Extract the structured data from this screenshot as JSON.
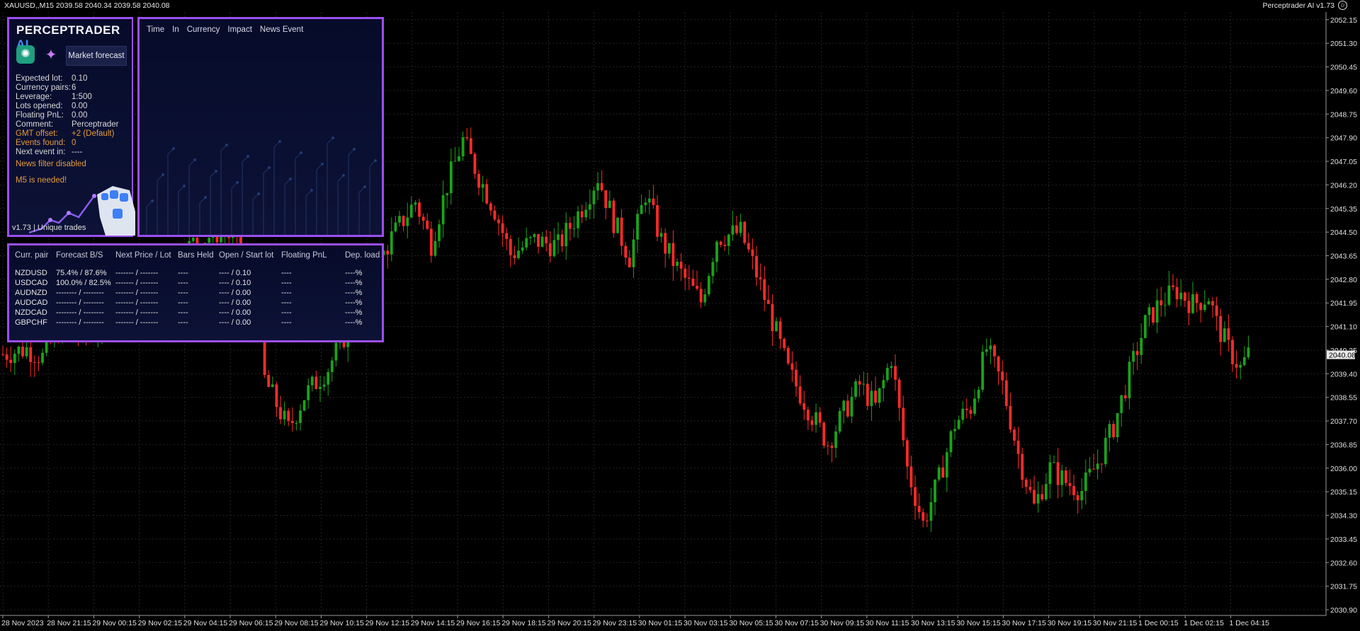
{
  "header": {
    "symbol_info": "XAUUSD,,M15  2039.58 2040.34 2039.58 2040.08",
    "ea_label": "Perceptrader AI v1.73"
  },
  "colors": {
    "bull": "#1aa31a",
    "bear": "#ff2a2a",
    "panel_border": "#9b4ff0",
    "orange": "#e59a3c",
    "logo_accent": "#3f8ff8"
  },
  "icons": {
    "chatgpt": "chatgpt-icon",
    "sparkle": "sparkle-icon",
    "smiley": "smiley-icon",
    "robot": "robot-hand-icon"
  },
  "panel": {
    "logo_main": "PERCEPTRADER",
    "logo_ai": " AI",
    "forecast_button": "Market forecast",
    "stats": [
      {
        "label": "Expected lot:",
        "value": "0.10",
        "orange": false
      },
      {
        "label": "Currency pairs:",
        "value": "6",
        "orange": false
      },
      {
        "label": "Leverage:",
        "value": "1:500",
        "orange": false
      },
      {
        "label": "Lots opened:",
        "value": "0.00",
        "orange": false
      },
      {
        "label": "Floating PnL:",
        "value": "0.00",
        "orange": false
      },
      {
        "label": "Comment:",
        "value": "Perceptrader",
        "orange": false
      },
      {
        "label": "GMT offset:",
        "value": "+2 (Default)",
        "orange": true
      },
      {
        "label": "Events found:",
        "value": "0",
        "orange": true
      },
      {
        "label": "Next event in:",
        "value": "----",
        "orange": false
      }
    ],
    "news_filter": "News filter disabled",
    "m5_needed": "M5 is needed!",
    "version": "v1.73 | Unique trades"
  },
  "news": {
    "headers": [
      "Time",
      "In",
      "Currency",
      "Impact",
      "News Event"
    ]
  },
  "pairs_table": {
    "headers": [
      "Curr. pair",
      "Forecast B/S",
      "Next Price / Lot",
      "Bars Held",
      "Open / Start lot",
      "Floating PnL",
      "Dep. load"
    ],
    "rows": [
      [
        "NZDUSD",
        "75.4% / 87.6%",
        "------- / -------",
        "----",
        "---- / 0.10",
        "----",
        "----%"
      ],
      [
        "USDCAD",
        "100.0% / 82.5%",
        "------- / -------",
        "----",
        "---- / 0.10",
        "----",
        "----%"
      ],
      [
        "AUDNZD",
        "-------- / --------",
        "------- / -------",
        "----",
        "---- / 0.00",
        "----",
        "----%"
      ],
      [
        "AUDCAD",
        "-------- / --------",
        "------- / -------",
        "----",
        "---- / 0.00",
        "----",
        "----%"
      ],
      [
        "NZDCAD",
        "-------- / --------",
        "------- / -------",
        "----",
        "---- / 0.00",
        "----",
        "----%"
      ],
      [
        "GBPCHF",
        "-------- / --------",
        "------- / -------",
        "----",
        "---- / 0.00",
        "----",
        "----%"
      ]
    ]
  },
  "chart_data": {
    "type": "candlestick",
    "symbol": "XAUUSD",
    "timeframe": "M15",
    "ylim": [
      2030.9,
      2052.4
    ],
    "y_ticks": [
      "2052.15",
      "2051.30",
      "2050.45",
      "2049.60",
      "2048.75",
      "2047.90",
      "2047.05",
      "2046.20",
      "2045.35",
      "2044.50",
      "2043.65",
      "2042.80",
      "2041.95",
      "2041.10",
      "2040.25",
      "2039.40",
      "2038.55",
      "2037.70",
      "2036.85",
      "2036.00",
      "2035.15",
      "2034.30",
      "2033.45",
      "2032.60",
      "2031.75",
      "2030.90"
    ],
    "current_price": "2040.08",
    "x_ticks": [
      "28 Nov 2023",
      "28 Nov 21:15",
      "29 Nov 00:15",
      "29 Nov 02:15",
      "29 Nov 04:15",
      "29 Nov 06:15",
      "29 Nov 08:15",
      "29 Nov 10:15",
      "29 Nov 12:15",
      "29 Nov 14:15",
      "29 Nov 16:15",
      "29 Nov 18:15",
      "29 Nov 20:15",
      "29 Nov 23:15",
      "30 Nov 01:15",
      "30 Nov 03:15",
      "30 Nov 05:15",
      "30 Nov 07:15",
      "30 Nov 09:15",
      "30 Nov 11:15",
      "30 Nov 13:15",
      "30 Nov 15:15",
      "30 Nov 17:15",
      "30 Nov 19:15",
      "30 Nov 21:15",
      "1 Dec 00:15",
      "1 Dec 02:15",
      "1 Dec 04:15"
    ],
    "grid": true,
    "anchors": [
      [
        0,
        2040.1
      ],
      [
        6,
        2040.3
      ],
      [
        10,
        2040.0
      ],
      [
        14,
        2041.0
      ],
      [
        20,
        2040.8
      ],
      [
        28,
        2041.5
      ],
      [
        34,
        2042.3
      ],
      [
        40,
        2043.0
      ],
      [
        48,
        2044.1
      ],
      [
        56,
        2044.6
      ],
      [
        62,
        2043.2
      ],
      [
        66,
        2039.2
      ],
      [
        72,
        2037.4
      ],
      [
        76,
        2038.6
      ],
      [
        82,
        2039.6
      ],
      [
        88,
        2041.3
      ],
      [
        92,
        2042.6
      ],
      [
        98,
        2044.3
      ],
      [
        104,
        2045.6
      ],
      [
        108,
        2044.1
      ],
      [
        112,
        2046.2
      ],
      [
        116,
        2047.8
      ],
      [
        120,
        2046.5
      ],
      [
        124,
        2045.3
      ],
      [
        128,
        2043.7
      ],
      [
        134,
        2044.2
      ],
      [
        140,
        2044.0
      ],
      [
        146,
        2045.4
      ],
      [
        150,
        2046.5
      ],
      [
        154,
        2044.9
      ],
      [
        158,
        2043.6
      ],
      [
        162,
        2045.9
      ],
      [
        166,
        2044.2
      ],
      [
        170,
        2043.2
      ],
      [
        176,
        2042.0
      ],
      [
        180,
        2044.3
      ],
      [
        186,
        2044.5
      ],
      [
        190,
        2043.0
      ],
      [
        194,
        2041.3
      ],
      [
        198,
        2039.5
      ],
      [
        204,
        2037.9
      ],
      [
        208,
        2036.9
      ],
      [
        212,
        2038.0
      ],
      [
        216,
        2039.0
      ],
      [
        220,
        2038.2
      ],
      [
        224,
        2040.0
      ],
      [
        228,
        2036.0
      ],
      [
        232,
        2034.0
      ],
      [
        236,
        2035.6
      ],
      [
        240,
        2037.6
      ],
      [
        244,
        2038.2
      ],
      [
        248,
        2040.3
      ],
      [
        252,
        2039.0
      ],
      [
        256,
        2036.5
      ],
      [
        260,
        2034.6
      ],
      [
        264,
        2036.0
      ],
      [
        268,
        2035.5
      ],
      [
        272,
        2035.2
      ],
      [
        276,
        2036.2
      ],
      [
        280,
        2037.5
      ],
      [
        284,
        2039.4
      ],
      [
        288,
        2041.2
      ],
      [
        292,
        2042.0
      ],
      [
        296,
        2042.4
      ],
      [
        300,
        2041.9
      ],
      [
        304,
        2042.2
      ],
      [
        306,
        2041.2
      ],
      [
        309,
        2040.3
      ],
      [
        312,
        2039.6
      ],
      [
        314,
        2040.1
      ]
    ]
  }
}
